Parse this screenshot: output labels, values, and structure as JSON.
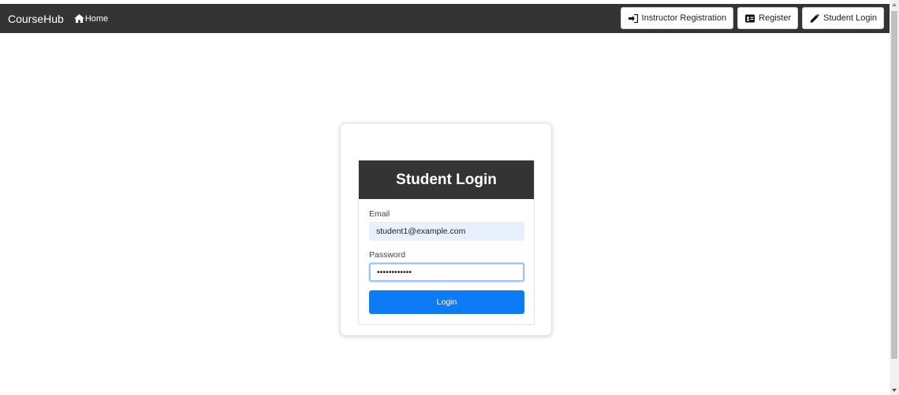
{
  "navbar": {
    "brand": "CourseHub",
    "home_label": "Home",
    "buttons": [
      {
        "label": "Instructor Registration",
        "icon": "sign-in-icon"
      },
      {
        "label": "Register",
        "icon": "id-card-icon"
      },
      {
        "label": "Student Login",
        "icon": "pencil-icon"
      }
    ]
  },
  "login": {
    "title": "Student Login",
    "email_label": "Email",
    "email_value": "student1@example.com",
    "password_label": "Password",
    "password_value": "••••••••••••",
    "submit_label": "Login"
  },
  "colors": {
    "navbar_bg": "#343434",
    "primary_button": "#0d7bf5",
    "autofill_bg": "#e8f0fe"
  }
}
